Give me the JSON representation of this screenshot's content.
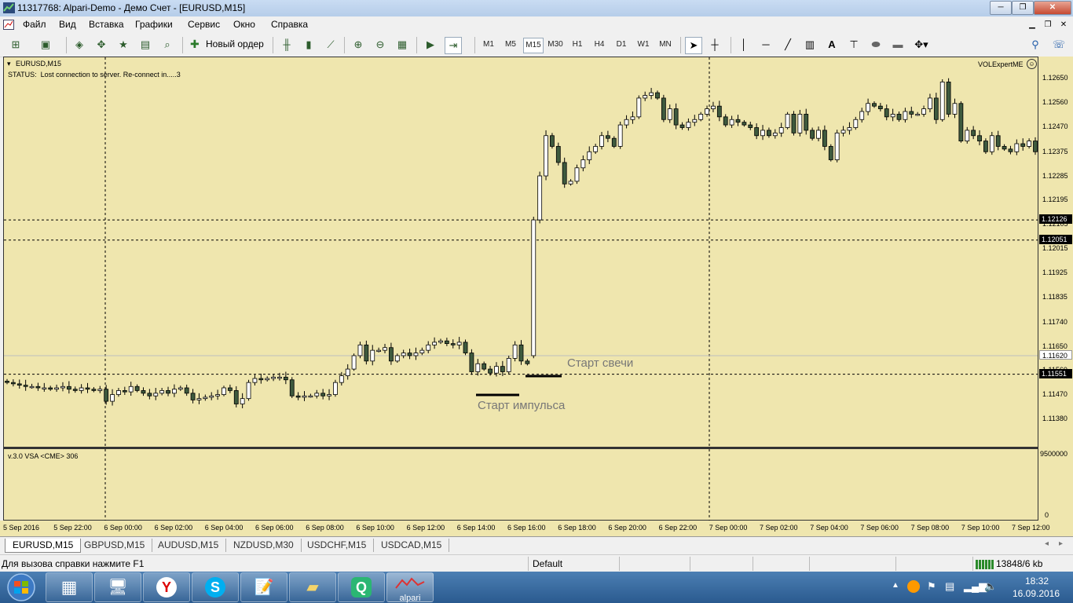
{
  "window": {
    "title": "11317768: Alpari-Demo - Демо Счет - [EURUSD,M15]",
    "controls": [
      "─",
      "❐",
      "✕"
    ]
  },
  "menu": [
    "Файл",
    "Вид",
    "Вставка",
    "Графики",
    "Сервис",
    "Окно",
    "Справка"
  ],
  "toolbar": {
    "new_order": "Новый ордер",
    "timeframes": [
      "M1",
      "M5",
      "M15",
      "M30",
      "H1",
      "H4",
      "D1",
      "W1",
      "MN"
    ],
    "active_timeframe": "M15",
    "text_tool": "A"
  },
  "chart": {
    "symbol_label": "EURUSD,M15",
    "status_line": "STATUS:  Lost connection to server. Re-connect in.....3",
    "expert_label": "VOLExpertME",
    "indicator_label": "v.3.0 VSA <CME> 306",
    "annotation_candle": "Старт свечи",
    "annotation_impulse": "Старт импульса",
    "price_ticks": [
      "1.12650",
      "1.12560",
      "1.12470",
      "1.12375",
      "1.12285",
      "1.12195",
      "1.12105",
      "1.12015",
      "1.11925",
      "1.11835",
      "1.11740",
      "1.11650",
      "1.11560",
      "1.11470",
      "1.11380"
    ],
    "highlighted_prices": [
      "1.12126",
      "1.12051",
      "1.11620",
      "1.11551"
    ],
    "subchart_ticks": [
      "9500000",
      "0"
    ],
    "time_ticks": [
      "5 Sep 2016",
      "5 Sep 22:00",
      "6 Sep 00:00",
      "6 Sep 02:00",
      "6 Sep 04:00",
      "6 Sep 06:00",
      "6 Sep 08:00",
      "6 Sep 10:00",
      "6 Sep 12:00",
      "6 Sep 14:00",
      "6 Sep 16:00",
      "6 Sep 18:00",
      "6 Sep 20:00",
      "6 Sep 22:00",
      "7 Sep 00:00",
      "7 Sep 02:00",
      "7 Sep 04:00",
      "7 Sep 06:00",
      "7 Sep 08:00",
      "7 Sep 10:00",
      "7 Sep 12:00"
    ],
    "colors": {
      "background": "#efe6ae",
      "bull_body": "#ffffff",
      "bear_body": "#3e5a3e",
      "wick": "#000000"
    }
  },
  "tabs": [
    "EURUSD,M15",
    "GBPUSD,M15",
    "AUDUSD,M15",
    "NZDUSD,M30",
    "USDCHF,M15",
    "USDCAD,M15"
  ],
  "active_tab": "EURUSD,M15",
  "status": {
    "help": "Для вызова справки нажмите F1",
    "profile": "Default",
    "traffic": "13848/6 kb"
  },
  "taskbar": {
    "apps": [
      "calculator-icon",
      "network-pc-icon",
      "yandex-icon",
      "skype-icon",
      "notepad-icon",
      "explorer-icon",
      "qip-icon",
      "alpari-icon"
    ],
    "y_label": "Y",
    "s_label": "S",
    "q_label": "Q",
    "alpari_label": "alpari",
    "clock_time": "18:32",
    "clock_date": "16.09.2016"
  },
  "chart_data": {
    "type": "candlestick",
    "symbol": "EURUSD",
    "timeframe": "M15",
    "ylim": [
      1.1138,
      1.1269
    ],
    "x_ticks": [
      "5 Sep 2016",
      "5 Sep 22:00",
      "6 Sep 00:00",
      "6 Sep 02:00",
      "6 Sep 04:00",
      "6 Sep 06:00",
      "6 Sep 08:00",
      "6 Sep 10:00",
      "6 Sep 12:00",
      "6 Sep 14:00",
      "6 Sep 16:00",
      "6 Sep 18:00",
      "6 Sep 20:00",
      "6 Sep 22:00",
      "7 Sep 00:00",
      "7 Sep 02:00",
      "7 Sep 04:00",
      "7 Sep 06:00",
      "7 Sep 08:00",
      "7 Sep 10:00",
      "7 Sep 12:00"
    ],
    "horizontal_lines": [
      1.12126,
      1.12051,
      1.1162,
      1.11551
    ],
    "close_series": [
      1.1152,
      1.11515,
      1.1151,
      1.11505,
      1.11505,
      1.115,
      1.115,
      1.11495,
      1.115,
      1.11505,
      1.11495,
      1.1149,
      1.115,
      1.11495,
      1.1149,
      1.11495,
      1.1145,
      1.11475,
      1.1149,
      1.11485,
      1.11505,
      1.1149,
      1.1148,
      1.1147,
      1.1148,
      1.1149,
      1.1148,
      1.11495,
      1.115,
      1.1148,
      1.11455,
      1.1146,
      1.11465,
      1.1147,
      1.11475,
      1.115,
      1.1149,
      1.1144,
      1.1146,
      1.1152,
      1.11535,
      1.1153,
      1.11535,
      1.1154,
      1.1154,
      1.1153,
      1.1147,
      1.11465,
      1.1147,
      1.1147,
      1.1148,
      1.1147,
      1.11475,
      1.1152,
      1.11545,
      1.1157,
      1.1162,
      1.1166,
      1.116,
      1.1164,
      1.1164,
      1.1165,
      1.116,
      1.1162,
      1.1163,
      1.1162,
      1.1163,
      1.1164,
      1.1166,
      1.1167,
      1.11675,
      1.11665,
      1.1166,
      1.1167,
      1.1163,
      1.1156,
      1.1159,
      1.1157,
      1.11555,
      1.1158,
      1.1156,
      1.1161,
      1.1166,
      1.116,
      1.1159,
      1.12126,
      1.1229,
      1.1244,
      1.124,
      1.1234,
      1.1226,
      1.1227,
      1.1232,
      1.1235,
      1.1238,
      1.124,
      1.1244,
      1.1243,
      1.124,
      1.1248,
      1.125,
      1.1251,
      1.1258,
      1.1259,
      1.126,
      1.1258,
      1.125,
      1.1254,
      1.1248,
      1.1247,
      1.1249,
      1.125,
      1.1252,
      1.1254,
      1.1255,
      1.1251,
      1.1248,
      1.125,
      1.1249,
      1.1248,
      1.1247,
      1.1244,
      1.1246,
      1.1244,
      1.1245,
      1.1247,
      1.1252,
      1.1245,
      1.1252,
      1.1246,
      1.1243,
      1.1246,
      1.124,
      1.1235,
      1.1245,
      1.1246,
      1.1247,
      1.125,
      1.1253,
      1.1256,
      1.1255,
      1.1254,
      1.1251,
      1.1252,
      1.125,
      1.1253,
      1.1252,
      1.1252,
      1.1254,
      1.1258,
      1.125,
      1.1264,
      1.1252,
      1.1256,
      1.1242,
      1.1246,
      1.1244,
      1.1242,
      1.1238,
      1.1244,
      1.124,
      1.1239,
      1.1238,
      1.1241,
      1.124,
      1.1242,
      1.1238
    ]
  }
}
